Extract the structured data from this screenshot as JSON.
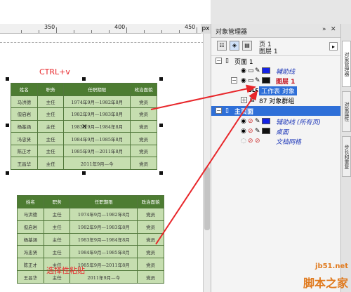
{
  "ruler": {
    "marks": [
      "350",
      "400",
      "450"
    ],
    "unit_icon": "px"
  },
  "annotations": {
    "ctrl_v": "CTRL+v",
    "paste_special": "选择性粘贴"
  },
  "table": {
    "headers": [
      "姓名",
      "职务",
      "任职期限",
      "政治面貌"
    ],
    "rows": [
      [
        "马洪德",
        "主任",
        "1974年9月—1982年8月",
        "党员"
      ],
      [
        "但启岩",
        "主任",
        "1982年9月—1983年8月",
        "党员"
      ],
      [
        "杨基涵",
        "主任",
        "1983年9月—1984年8月",
        "党员"
      ],
      [
        "冯忠贤",
        "主任",
        "1984年9月—1985年8月",
        "党员"
      ],
      [
        "陈正才",
        "主任",
        "1985年9月—2011年8月",
        "党员"
      ],
      [
        "王昌华",
        "主任",
        "2011年9月—今",
        "党员"
      ]
    ]
  },
  "panel": {
    "title": "对象管理器",
    "page_label": "页 1",
    "layer_label": "图层 1",
    "tree": {
      "page1": "页面 1",
      "guides": "辅助线",
      "layer1": "图层 1",
      "worksheet_object": "工作表 对象",
      "group": "87 对象群组",
      "master": "主页面",
      "guides_all": "辅助线 (所有页)",
      "desktop": "桌面",
      "doc_grid": "文档网格"
    }
  },
  "side_tabs": [
    "对象管理器",
    "对象属性",
    "步长和重复"
  ],
  "watermark": {
    "line1": "jb51.net",
    "line2": "脚本之家"
  },
  "colors": {
    "table_header": "#4d7c32",
    "table_body": "#c6deb0",
    "annotation": "#e8262a",
    "selection": "#2e6fd8"
  }
}
